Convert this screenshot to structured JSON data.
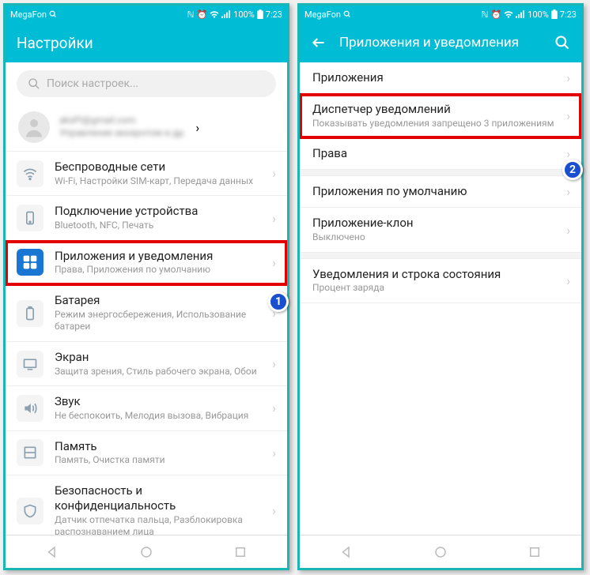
{
  "statusbar": {
    "carrier": "MegaFon",
    "battery": "100%",
    "time": "7:23"
  },
  "left": {
    "title": "Настройки",
    "search_placeholder": "Поиск настроек...",
    "account": {
      "line1": "aksPi@gmail.com",
      "line2": "Управление аккаунтом и др."
    },
    "items": [
      {
        "title": "Беспроводные сети",
        "sub": "Wi-Fi, Настройки SIM-карт, Передача данных",
        "icon": "wifi",
        "hl": false
      },
      {
        "title": "Подключение устройства",
        "sub": "Bluetooth, NFC, Печать",
        "icon": "device",
        "hl": false
      },
      {
        "title": "Приложения и уведомления",
        "sub": "Права, Приложения по умолчанию",
        "icon": "apps",
        "hl": true
      },
      {
        "title": "Батарея",
        "sub": "Режим энергосбережения, Использование батареи",
        "icon": "battery",
        "hl": false
      },
      {
        "title": "Экран",
        "sub": "Защита зрения, Стиль рабочего экрана, Обои",
        "icon": "display",
        "hl": false
      },
      {
        "title": "Звук",
        "sub": "Не беспокоить, Мелодия вызова, Вибрация",
        "icon": "sound",
        "hl": false
      },
      {
        "title": "Память",
        "sub": "Память, Очистка памяти",
        "icon": "storage",
        "hl": false
      },
      {
        "title": "Безопасность и конфиденциальность",
        "sub": "Датчик отпечатка пальца, Разблокировка распознаванием лица",
        "icon": "security",
        "hl": false
      }
    ],
    "badge": "1"
  },
  "right": {
    "title": "Приложения и уведомления",
    "items": [
      {
        "title": "Приложения",
        "sub": "",
        "hl": false
      },
      {
        "title": "Диспетчер уведомлений",
        "sub": "Показывать уведомления запрещено 3 приложениям",
        "hl": true
      },
      {
        "title": "Права",
        "sub": "",
        "hl": false
      },
      {
        "title": "Приложения по умолчанию",
        "sub": "",
        "hl": false,
        "gap_before": true
      },
      {
        "title": "Приложение-клон",
        "sub": "Выключено",
        "hl": false
      },
      {
        "title": "Уведомления и строка состояния",
        "sub": "Процент заряда",
        "hl": false,
        "gap_before": true
      }
    ],
    "badge": "2"
  }
}
